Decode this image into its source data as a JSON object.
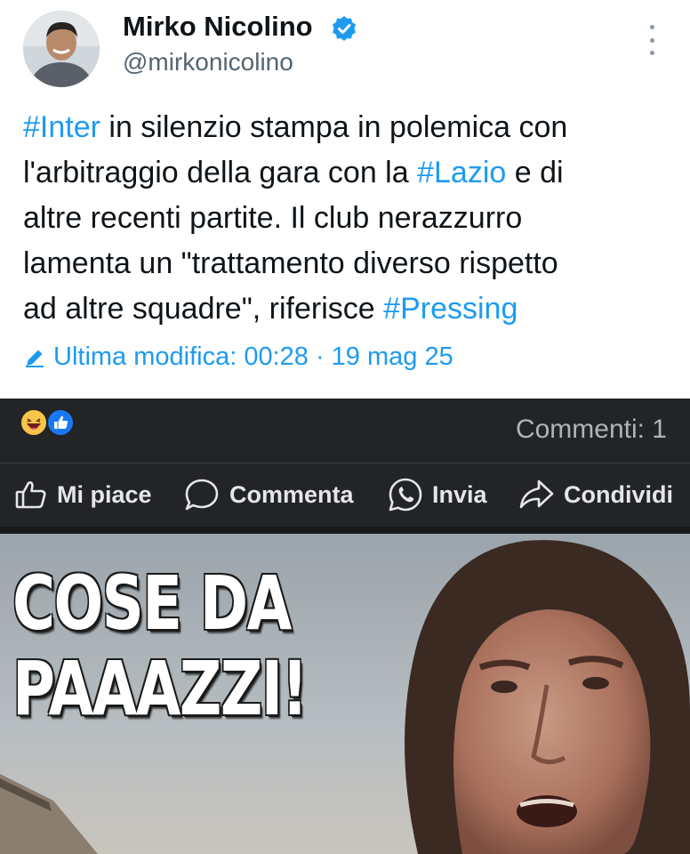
{
  "tweet": {
    "author_name": "Mirko Nicolino",
    "handle": "@mirkonicolino",
    "verified": true,
    "text_lines": [
      [
        {
          "t": "#Inter",
          "tag": true
        },
        {
          "t": " in silenzio stampa in polemica con",
          "tag": false
        }
      ],
      [
        {
          "t": "l'arbitraggio della gara con la ",
          "tag": false
        },
        {
          "t": "#Lazio",
          "tag": true
        },
        {
          "t": " e di",
          "tag": false
        }
      ],
      [
        {
          "t": "altre recenti partite. Il club nerazzurro",
          "tag": false
        }
      ],
      [
        {
          "t": "lamenta un \"trattamento diverso rispetto",
          "tag": false
        }
      ],
      [
        {
          "t": "ad altre squadre\", riferisce ",
          "tag": false
        },
        {
          "t": "#Pressing",
          "tag": true
        }
      ]
    ],
    "edited_label": "Ultima modifica: 00:28 · 19 mag 25",
    "colors": {
      "link": "#1d9bf0",
      "text": "#0f1419",
      "secondary": "#536471"
    }
  },
  "facebook": {
    "reactions": [
      "haha-emoji-icon",
      "like-emoji-icon"
    ],
    "comments_label": "Commenti: 1",
    "actions": {
      "like": "Mi piace",
      "comment": "Commenta",
      "send": "Invia",
      "share": "Condividi"
    },
    "colors": {
      "bar": "#232426",
      "text": "#e4e6eb",
      "muted": "#b0b3b8"
    }
  },
  "meme": {
    "line1": "COSE DA",
    "line2": "PAAAZZI!"
  }
}
